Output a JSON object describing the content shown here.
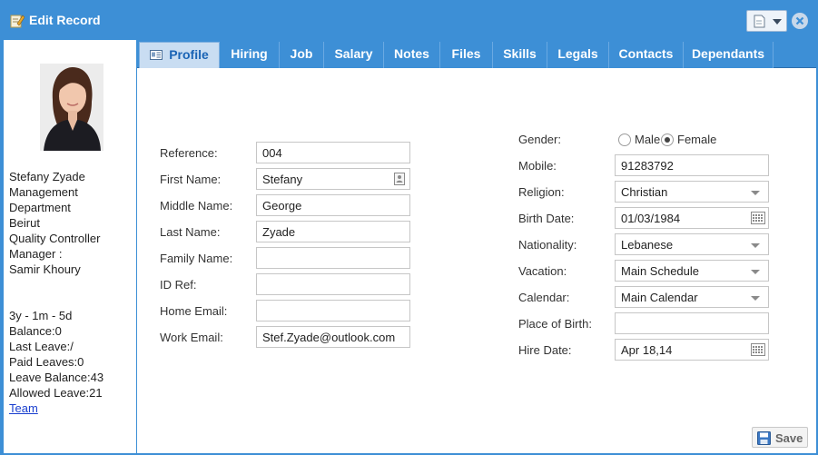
{
  "window": {
    "title": "Edit Record"
  },
  "employee": {
    "lines": [
      "Stefany Zyade",
      "Management",
      "Department",
      "Beirut",
      "Quality Controller",
      "Manager :",
      "Samir Khoury"
    ],
    "stats": [
      "3y - 1m - 5d",
      "Balance:0",
      "Last Leave:/",
      "Paid Leaves:0",
      "Leave Balance:43",
      "Allowed Leave:21"
    ],
    "team_link": "Team"
  },
  "tabs": [
    {
      "label": "Profile",
      "active": true
    },
    {
      "label": "Hiring",
      "active": false
    },
    {
      "label": "Job",
      "active": false
    },
    {
      "label": "Salary",
      "active": false
    },
    {
      "label": "Notes",
      "active": false
    },
    {
      "label": "Files",
      "active": false
    },
    {
      "label": "Skills",
      "active": false
    },
    {
      "label": "Legals",
      "active": false
    },
    {
      "label": "Contacts",
      "active": false
    },
    {
      "label": "Dependants",
      "active": false
    }
  ],
  "form_left": {
    "reference": {
      "label": "Reference:",
      "value": "004"
    },
    "first_name": {
      "label": "First Name:",
      "value": "Stefany"
    },
    "middle_name": {
      "label": "Middle Name:",
      "value": "George"
    },
    "last_name": {
      "label": "Last Name:",
      "value": "Zyade"
    },
    "family_name": {
      "label": "Family Name:",
      "value": ""
    },
    "id_ref": {
      "label": "ID Ref:",
      "value": ""
    },
    "home_email": {
      "label": "Home Email:",
      "value": ""
    },
    "work_email": {
      "label": "Work Email:",
      "value": "Stef.Zyade@outlook.com"
    }
  },
  "form_right": {
    "gender": {
      "label": "Gender:",
      "options": [
        "Male",
        "Female"
      ],
      "selected": "Female"
    },
    "mobile": {
      "label": "Mobile:",
      "value": "91283792"
    },
    "religion": {
      "label": "Religion:",
      "value": "Christian"
    },
    "birth_date": {
      "label": "Birth Date:",
      "value": "01/03/1984"
    },
    "nationality": {
      "label": "Nationality:",
      "value": "Lebanese"
    },
    "vacation": {
      "label": "Vacation:",
      "value": "Main Schedule"
    },
    "calendar": {
      "label": "Calendar:",
      "value": "Main Calendar"
    },
    "place_of_birth": {
      "label": "Place of Birth:",
      "value": ""
    },
    "hire_date": {
      "label": "Hire Date:",
      "value": "Apr 18,14"
    }
  },
  "actions": {
    "save_label": "Save"
  },
  "icons": {
    "title": "edit-icon",
    "menu": "document-icon",
    "close": "close-icon",
    "profile_tab": "id-card-icon",
    "contact": "contact-card-icon",
    "calendar": "calendar-icon",
    "save": "floppy-disk-icon"
  },
  "colors": {
    "accent": "#3d8fd6",
    "active_tab_bg": "#c9ddf2",
    "link": "#1a3fcf"
  }
}
